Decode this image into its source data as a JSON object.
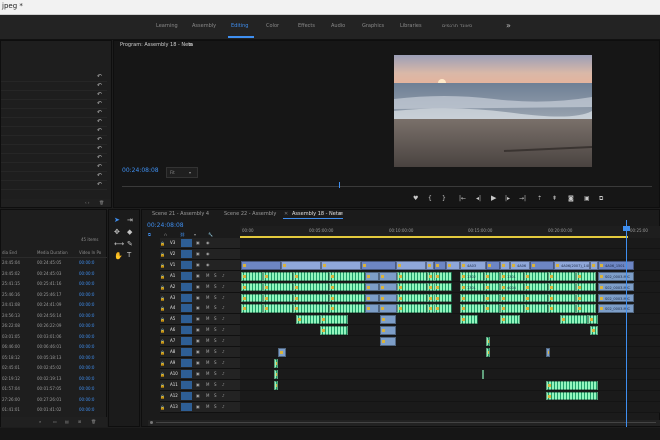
{
  "window": {
    "title": "jpeg *"
  },
  "workspaces": [
    {
      "label": "Learning"
    },
    {
      "label": "Assembly"
    },
    {
      "label": "Editing",
      "active": true
    },
    {
      "label": "Color"
    },
    {
      "label": "Effects"
    },
    {
      "label": "Audio"
    },
    {
      "label": "Graphics"
    },
    {
      "label": "Libraries"
    },
    {
      "label": "סאונד תרגמים"
    }
  ],
  "workspaces_more": "»",
  "program_monitor": {
    "title": "Program: Assembly 18 - Neta",
    "menu_glyph": "≡",
    "timecode": "00:24:08:08",
    "fit": "Fit"
  },
  "history_panel": {
    "undo_glyph": "↶",
    "rows": 13
  },
  "project_panel": {
    "item_count": "45 items",
    "columns": [
      "dia End",
      "Media Duration",
      "Video In Po"
    ],
    "rows": [
      [
        "24:45:04",
        "00:24:45:05",
        "00:00:0"
      ],
      [
        "24:45:02",
        "00:24:45:03",
        "00:00:0"
      ],
      [
        "25:41:15",
        "00:25:41:16",
        "00:00:0"
      ],
      [
        "25:46:16",
        "00:25:46:17",
        "00:00:0"
      ],
      [
        "24:41:08",
        "00:24:41:09",
        "00:00:0"
      ],
      [
        "24:56:13",
        "00:24:56:14",
        "00:00:0"
      ],
      [
        "26:22:08",
        "00:26:22:09",
        "00:00:0"
      ],
      [
        "03:01:05",
        "00:03:01:06",
        "00:00:0"
      ],
      [
        "06:46:00",
        "00:06:46:01",
        "00:00:0"
      ],
      [
        "05:18:12",
        "00:05:18:13",
        "00:00:0"
      ],
      [
        "02:45:01",
        "00:02:45:02",
        "00:00:0"
      ],
      [
        "02:19:12",
        "00:02:19:13",
        "00:00:0"
      ],
      [
        "01:57:04",
        "00:01:57:05",
        "00:00:0"
      ],
      [
        "27:26:00",
        "00:27:26:01",
        "00:00:0"
      ],
      [
        "01:41:01",
        "00:01:41:02",
        "00:00:0"
      ]
    ]
  },
  "timeline": {
    "tabs": [
      {
        "label": "Scene 21 - Assembly 4"
      },
      {
        "label": "Scene 22 - Assembly"
      },
      {
        "label": "Assembly 18 - Neta",
        "active": true,
        "menu": "≡"
      }
    ],
    "timecode": "00:24:08:08",
    "ruler": [
      "00:00",
      "00:05:00:00",
      "00:10:00:00",
      "00:15:00:00",
      "00:20:00:00",
      "00:25:00"
    ],
    "video_tracks": [
      "V3",
      "V2",
      "V1"
    ],
    "audio_tracks": [
      "A1",
      "A2",
      "A3",
      "A4",
      "A5",
      "A6",
      "A7",
      "A8",
      "A9",
      "A10",
      "A11",
      "A12",
      "A13"
    ],
    "toggle_labels": {
      "mute": "M",
      "solo": "S"
    },
    "clip_labels": [
      "4A03",
      "4A06",
      "4A06(2)",
      "4A06(2007)_1401(1)",
      "4A06_1501",
      "4A06_2003",
      "1302",
      "1301",
      "4004",
      "1301",
      "4004",
      "S02_0003.MIC",
      "S02_0003.MIC",
      "S02_0003.MIC",
      "S02_0003.MIC",
      "S02_0003.MIC"
    ]
  },
  "colors": {
    "accent": "#3f8ff0",
    "video_clip": "#8fa7d9",
    "audio_clip": "#1f9d6a",
    "playhead": "#3f8ff0",
    "inout": "#e3c93d"
  },
  "icons": [
    "undo-icon",
    "play-icon",
    "step-back-icon",
    "step-forward-icon",
    "marker-icon",
    "in-point-icon",
    "out-point-icon",
    "lift-icon",
    "extract-icon",
    "camera-icon",
    "export-icon",
    "selection-tool-icon",
    "track-select-icon",
    "ripple-edit-icon",
    "razor-icon",
    "slip-icon",
    "pen-icon",
    "hand-icon",
    "type-icon",
    "search-icon",
    "folder-icon",
    "trash-icon",
    "new-item-icon",
    "snap-icon",
    "link-icon",
    "marker-add-icon",
    "wrench-icon",
    "lock-icon",
    "eye-icon",
    "mic-icon"
  ]
}
